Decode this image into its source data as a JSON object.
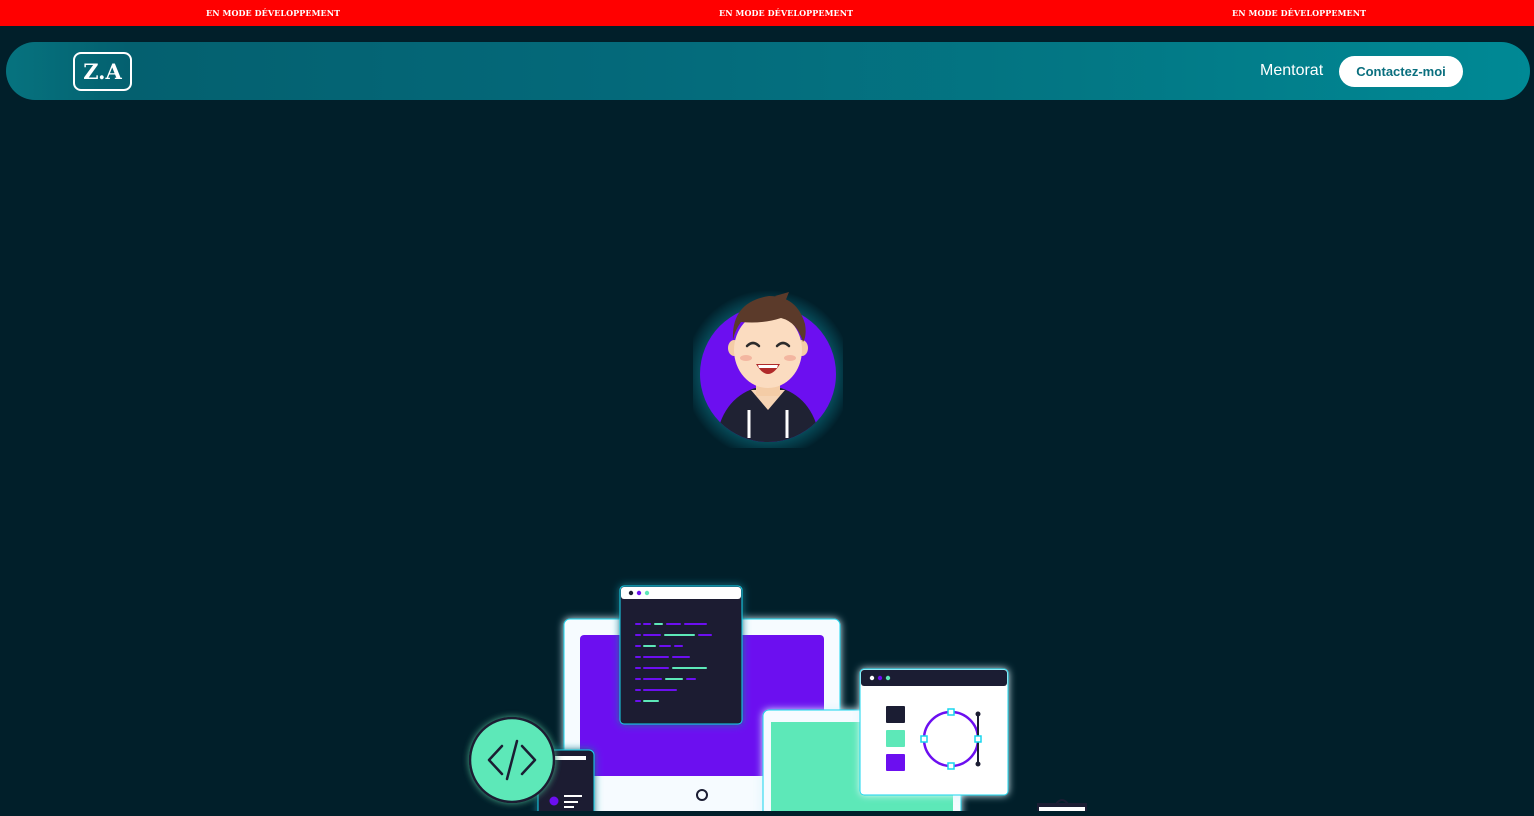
{
  "dev_banner": {
    "messages": [
      "EN MODE DÉVELOPPEMENT",
      "EN MODE DÉVELOPPEMENT",
      "EN MODE DÉVELOPPEMENT"
    ]
  },
  "navbar": {
    "logo_text": "Z.A",
    "links": [
      {
        "label": "Mentorat"
      }
    ],
    "cta_label": "Contactez-moi"
  },
  "hero": {
    "avatar_icon": "smiling-developer-avatar",
    "illustration_icon": "devices-code-design-illustration"
  },
  "colors": {
    "banner": "#ff0000",
    "background": "#011f2a",
    "navbar": "#04697a",
    "accent_purple": "#6c0ff0",
    "accent_green": "#5de8b8"
  }
}
